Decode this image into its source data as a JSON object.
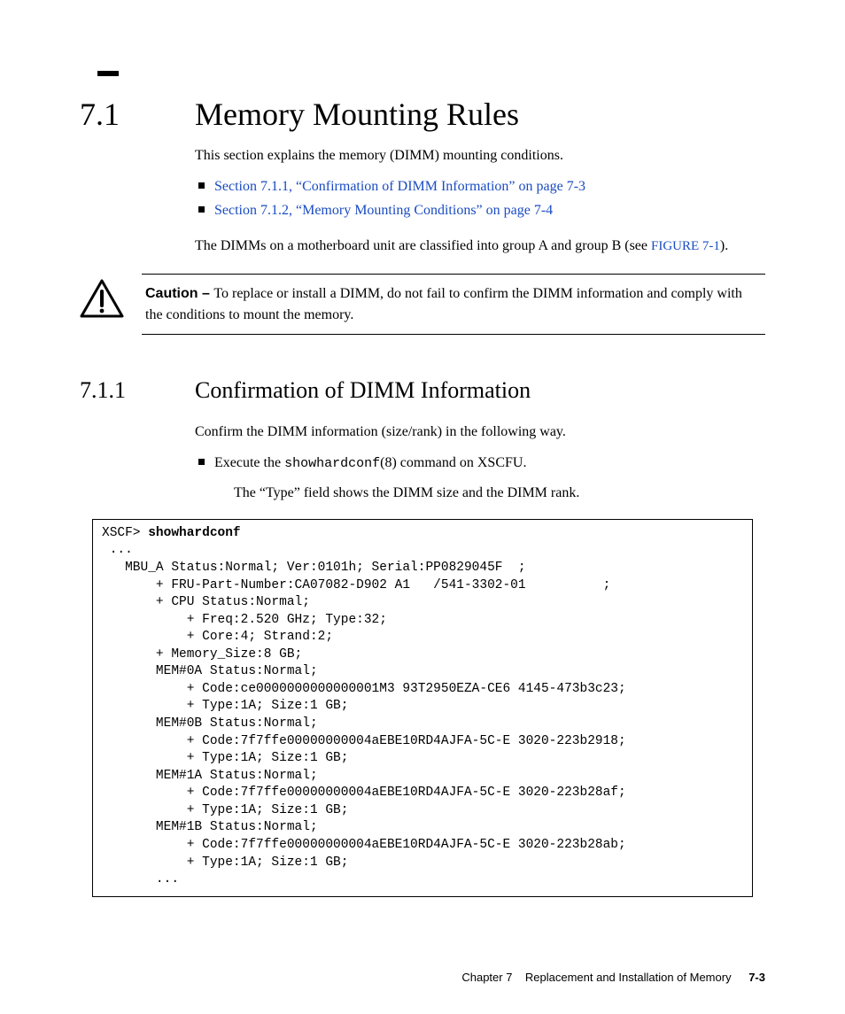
{
  "section": {
    "number": "7.1",
    "title": "Memory Mounting Rules",
    "intro": "This section explains the memory (DIMM) mounting conditions.",
    "links": [
      "Section 7.1.1, “Confirmation of DIMM Information” on page 7-3",
      "Section 7.1.2, “Memory Mounting Conditions” on page 7-4"
    ],
    "para2_pre": "The DIMMs on a motherboard unit are classified into group A and group B (see ",
    "figure_ref": "FIGURE 7-1",
    "para2_post": ")."
  },
  "caution": {
    "label": "Caution – ",
    "text": "To replace or install a DIMM, do not fail to confirm the DIMM information and comply with the conditions to mount the memory."
  },
  "subsection": {
    "number": "7.1.1",
    "title": "Confirmation of DIMM Information",
    "intro": "Confirm the DIMM information (size/rank) in the following way.",
    "bullet_pre": "Execute the ",
    "bullet_code": "showhardconf",
    "bullet_post": "(8) command on XSCFU.",
    "sub": "The “Type” field shows the DIMM size and the DIMM rank."
  },
  "code": {
    "prompt": "XSCF> ",
    "cmd": "showhardconf",
    "body": " ...\n   MBU_A Status:Normal; Ver:0101h; Serial:PP0829045F  ;\n       + FRU-Part-Number:CA07082-D902 A1   /541-3302-01          ;\n       + CPU Status:Normal;\n           + Freq:2.520 GHz; Type:32;\n           + Core:4; Strand:2;\n       + Memory_Size:8 GB;\n       MEM#0A Status:Normal;\n           + Code:ce0000000000000001M3 93T2950EZA-CE6 4145-473b3c23;\n           + Type:1A; Size:1 GB;\n       MEM#0B Status:Normal;\n           + Code:7f7ffe00000000004aEBE10RD4AJFA-5C-E 3020-223b2918;\n           + Type:1A; Size:1 GB;\n       MEM#1A Status:Normal;\n           + Code:7f7ffe00000000004aEBE10RD4AJFA-5C-E 3020-223b28af;\n           + Type:1A; Size:1 GB;\n       MEM#1B Status:Normal;\n           + Code:7f7ffe00000000004aEBE10RD4AJFA-5C-E 3020-223b28ab;\n           + Type:1A; Size:1 GB;\n       ..."
  },
  "footer": {
    "chapter": "Chapter 7",
    "title": "Replacement and Installation of Memory",
    "page": "7-3"
  }
}
